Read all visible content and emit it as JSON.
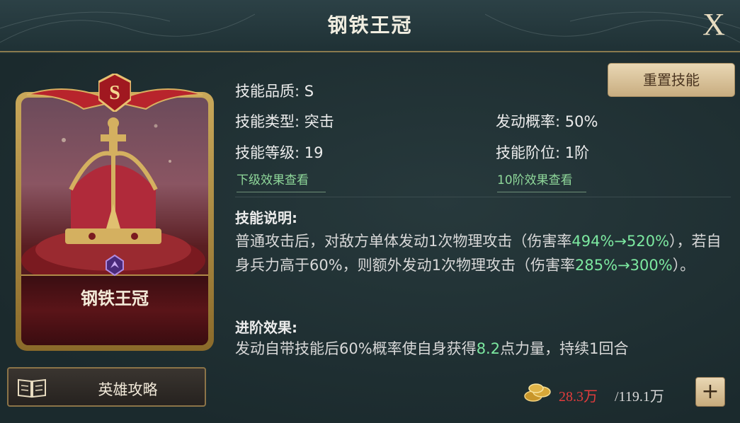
{
  "header": {
    "title": "钢铁王冠",
    "close_label": "X"
  },
  "card": {
    "quality": "S",
    "name": "钢铁王冠",
    "art_icon": "crown-icon",
    "type_icon": "assault-emblem-icon"
  },
  "strategy_button": {
    "label": "英雄攻略",
    "icon": "book-icon"
  },
  "reset_button": {
    "label": "重置技能"
  },
  "stats": {
    "quality": "技能品质: S",
    "type": "技能类型: 突击",
    "rate": "发动概率: 50%",
    "level": "技能等级: 19",
    "tier": "技能阶位: 1阶",
    "next_level_link": "下级效果查看",
    "tier10_link": "10阶效果查看"
  },
  "description": {
    "title": "技能说明:",
    "p1": "普通攻击后，对敌方单体发动1次物理攻击（伤害率",
    "v1": "494%→520%",
    "p2": "），若自身兵力高于60%，则额外发动1次物理攻击（伤害率",
    "v2": "285%→300%",
    "p3": "）。"
  },
  "advance": {
    "title": "进阶效果:",
    "p1": "发动自带技能后60%概率使自身获得",
    "v1": "8.2",
    "p2": "点力量，持续1回合"
  },
  "resource": {
    "icon": "gold-coins-icon",
    "current": "28.3万",
    "max": "/119.1万",
    "add_label": "+"
  },
  "colors": {
    "accent_green": "#7ce8a0",
    "warn_red": "#e23c3c",
    "gold": "#c9a85a"
  }
}
